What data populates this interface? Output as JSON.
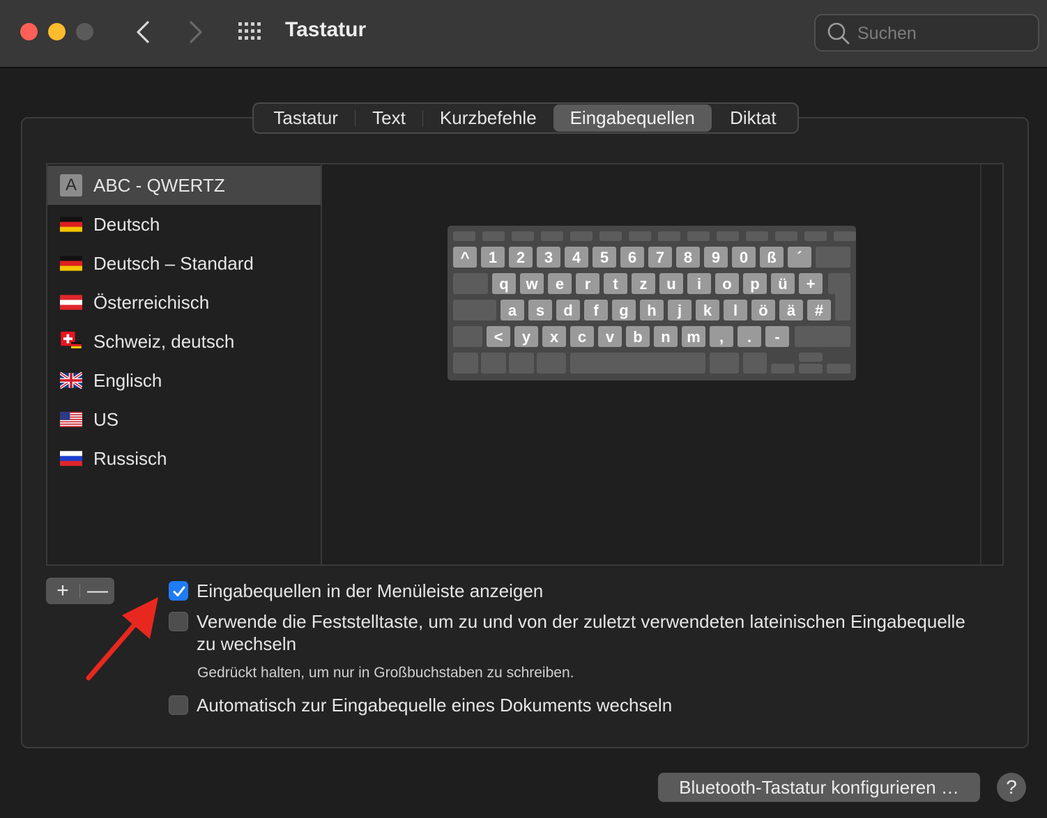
{
  "window": {
    "title": "Tastatur",
    "search_placeholder": "Suchen"
  },
  "tabs": [
    {
      "label": "Tastatur"
    },
    {
      "label": "Text"
    },
    {
      "label": "Kurzbefehle"
    },
    {
      "label": "Eingabequellen",
      "active": true
    },
    {
      "label": "Diktat"
    }
  ],
  "sources": [
    {
      "label": "ABC - QWERTZ",
      "icon": "letter-a-icon",
      "selected": true
    },
    {
      "label": "Deutsch",
      "icon": "flag-germany-icon"
    },
    {
      "label": "Deutsch – Standard",
      "icon": "flag-germany-icon"
    },
    {
      "label": "Österreichisch",
      "icon": "flag-austria-icon"
    },
    {
      "label": "Schweiz, deutsch",
      "icon": "flag-switzerland-germany-icon"
    },
    {
      "label": "Englisch",
      "icon": "flag-uk-icon"
    },
    {
      "label": "US",
      "icon": "flag-us-icon"
    },
    {
      "label": "Russisch",
      "icon": "flag-russia-icon"
    }
  ],
  "keyboard": {
    "row1": [
      "^",
      "1",
      "2",
      "3",
      "4",
      "5",
      "6",
      "7",
      "8",
      "9",
      "0",
      "ß",
      "´"
    ],
    "row2": [
      "q",
      "w",
      "e",
      "r",
      "t",
      "z",
      "u",
      "i",
      "o",
      "p",
      "ü",
      "+"
    ],
    "row3": [
      "a",
      "s",
      "d",
      "f",
      "g",
      "h",
      "j",
      "k",
      "l",
      "ö",
      "ä",
      "#"
    ],
    "row4": [
      "<",
      "y",
      "x",
      "c",
      "v",
      "b",
      "n",
      "m",
      ",",
      ".",
      "-"
    ]
  },
  "list_buttons": {
    "add": "+",
    "remove": "—"
  },
  "options": {
    "show_in_menubar": {
      "label": "Eingabequellen in der Menüleiste anzeigen",
      "checked": true
    },
    "capslock_switch": {
      "label_line1": "Verwende die Feststelltaste, um zu und von der zuletzt verwendeten lateinischen Eingabequelle",
      "label_line2": "zu wechseln",
      "checked": false
    },
    "capslock_hint": "Gedrückt halten, um nur in Großbuchstaben zu schreiben.",
    "auto_switch": {
      "label": "Automatisch zur Eingabequelle eines Dokuments wechseln",
      "checked": false
    }
  },
  "footer": {
    "bluetooth_button": "Bluetooth-Tastatur konfigurieren …",
    "help": "?"
  },
  "colors": {
    "accent": "#1f7cf5",
    "annotation_arrow": "#e8281e"
  }
}
